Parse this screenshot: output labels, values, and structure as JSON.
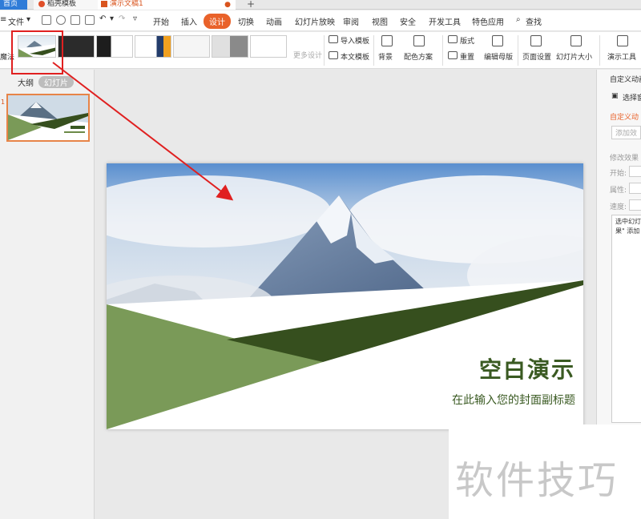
{
  "tabs": {
    "home": "首页",
    "docer": "稻壳模板",
    "document": "演示文稿1",
    "new_tab": "+"
  },
  "menubar": {
    "file": "文件",
    "items": [
      "开始",
      "插入",
      "设计",
      "切换",
      "动画",
      "幻灯片放映",
      "审阅",
      "视图",
      "安全",
      "开发工具",
      "特色应用"
    ],
    "active": "设计",
    "search": "查找"
  },
  "ribbon": {
    "left_cut_label": "魔法",
    "more_templates": "更多设计",
    "import_template": "导入模板",
    "body_template": "本文模板",
    "background": "背景",
    "color_scheme": "配色方案",
    "layout": "版式",
    "reset": "重置",
    "edit_master": "编辑母版",
    "page_setup": "页面设置",
    "slide_size": "幻灯片大小",
    "presentation_tools": "演示工具"
  },
  "leftpane": {
    "outline_tab": "大纲",
    "slides_tab": "幻灯片",
    "slide_number": "1"
  },
  "slide": {
    "title": "空白演示",
    "subtitle": "在此输入您的封面副标题"
  },
  "rightpane": {
    "heading": "自定义动画",
    "select_pane": "选择窗格",
    "custom_animation": "自定义动",
    "add_effect": "添加效",
    "modify_effect": "修改效果",
    "start": "开始:",
    "property": "属性:",
    "speed": "速度:",
    "hint_line1": "选中幻灯",
    "hint_line2": "果\" 添加"
  },
  "watermark": "软件技巧",
  "colors": {
    "accent": "#e9622a",
    "slide_green": "#7a9a58",
    "slide_dark_green": "#364f1e",
    "annotation_red": "#e02020"
  }
}
